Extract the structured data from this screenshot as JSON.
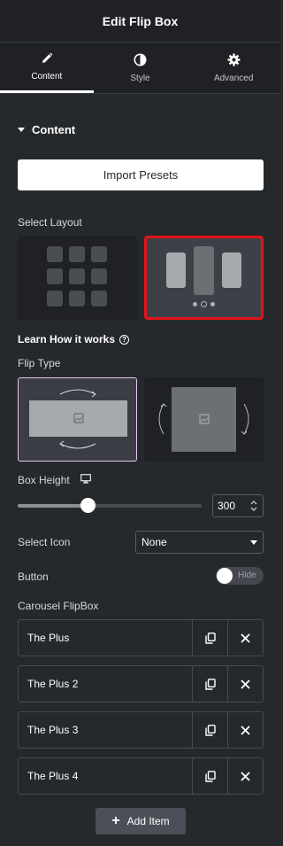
{
  "header": {
    "title": "Edit Flip Box"
  },
  "tabs": [
    {
      "label": "Content",
      "icon": "pencil-icon",
      "active": true
    },
    {
      "label": "Style",
      "icon": "half-circle-icon",
      "active": false
    },
    {
      "label": "Advanced",
      "icon": "gear-icon",
      "active": false
    }
  ],
  "section": {
    "title": "Content"
  },
  "import_button": {
    "label": "Import Presets"
  },
  "select_layout": {
    "label": "Select Layout",
    "options": [
      "grid-layout",
      "carousel-layout"
    ],
    "selected": "carousel-layout"
  },
  "learn_link": {
    "label": "Learn How it works",
    "icon": "question-circle-icon"
  },
  "flip_type": {
    "label": "Flip Type",
    "options": [
      "horizontal-flip",
      "vertical-flip"
    ],
    "selected": "horizontal-flip"
  },
  "box_height": {
    "label": "Box Height",
    "icon": "desktop-icon",
    "value": "300",
    "slider_fraction": 0.39
  },
  "select_icon": {
    "label": "Select Icon",
    "value": "None"
  },
  "button_toggle": {
    "label": "Button",
    "state": "Hide"
  },
  "carousel": {
    "label": "Carousel FlipBox",
    "items": [
      {
        "name": "The Plus"
      },
      {
        "name": "The Plus 2"
      },
      {
        "name": "The Plus 3"
      },
      {
        "name": "The Plus 4"
      }
    ],
    "add_label": "Add Item"
  },
  "colors": {
    "panel_bg": "#26292c",
    "header_bg": "#1f2124",
    "selected_border": "#e2131a",
    "flip_selected_border": "#e8c5ef"
  }
}
